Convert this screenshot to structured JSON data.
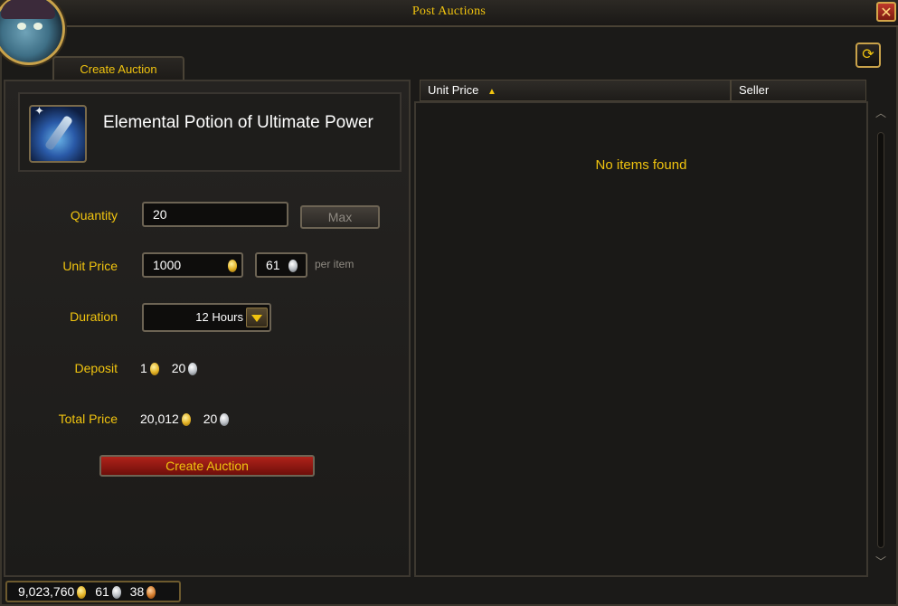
{
  "window": {
    "title": "Post Auctions",
    "close_glyph": "✕"
  },
  "tabs": {
    "create_auction": "Create Auction"
  },
  "item": {
    "name": "Elemental Potion of Ultimate Power",
    "icon": "potion-icon"
  },
  "form": {
    "quantity_label": "Quantity",
    "quantity_value": "20",
    "max_label": "Max",
    "unit_price_label": "Unit Price",
    "unit_price_gold": "1000",
    "unit_price_silver": "61",
    "per_item": "per item",
    "duration_label": "Duration",
    "duration_value": "12 Hours",
    "deposit_label": "Deposit",
    "deposit_gold": "1",
    "deposit_silver": "20",
    "total_label": "Total Price",
    "total_gold": "20,012",
    "total_silver": "20",
    "create_button": "Create Auction"
  },
  "results": {
    "columns": [
      "Unit Price",
      "Seller"
    ],
    "sort_glyph": "▲",
    "empty_message": "No items found",
    "refresh_glyph": "⟳"
  },
  "money": {
    "gold": "9,023,760",
    "silver": "61",
    "copper": "38"
  },
  "colors": {
    "accent_gold": "#f1c40f",
    "button_red": "#b0231a"
  }
}
